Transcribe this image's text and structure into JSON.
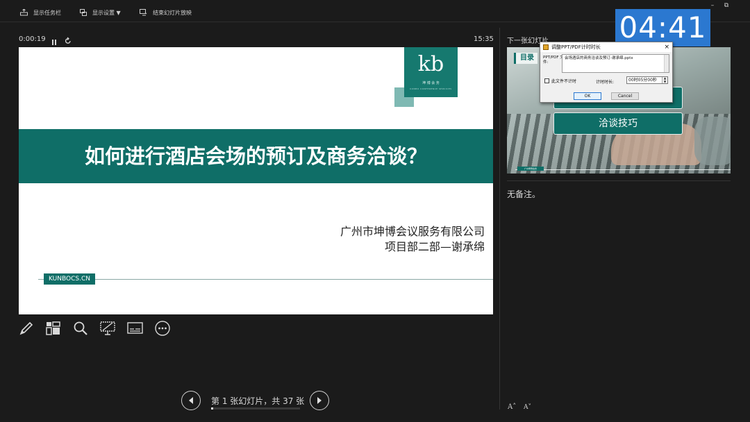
{
  "toolbar": {
    "show_taskbar": "显示任务栏",
    "display_settings": "显示设置 ▼",
    "end_show": "结束幻灯片放映"
  },
  "window": {
    "minimize": "–",
    "restore": "⧉"
  },
  "timer": {
    "countdown": "04:41"
  },
  "presenter": {
    "elapsed": "0:00:19",
    "clock": "15:35"
  },
  "slide": {
    "title": "如何进行酒店会场的预订及商务洽谈？",
    "company": "广州市坤博会议服务有限公司",
    "dept": "项目部二部—谢承绵",
    "url": "KUNBOCS.CN",
    "logo_glyph": "kb",
    "logo_sub": "坤 博 会 务",
    "logo_sub2": "KUNBO CONFERENCE SERVICES"
  },
  "nav": {
    "counter": "第 1 张幻灯片，共 37 张",
    "current": 1,
    "total": 37
  },
  "next_slide": {
    "label": "下一张幻灯片",
    "mulu": "目录",
    "item2": "洽谈技巧",
    "badge": "广州坤博会务"
  },
  "notes": {
    "text": "无备注。"
  },
  "font_controls": {
    "larger": "A˄",
    "smaller": "A˅"
  },
  "dialog": {
    "title": "调整PPT/PDF计时时长",
    "close": "×",
    "file_label": "PPT/PDF 文件:",
    "file_value": "会场酒店的商务洽谈及预订-谢承绵.pptx",
    "no_timer_label": "此文件不计时",
    "duration_label": "计时时长:",
    "duration_value": "00时05分00秒",
    "ok": "OK",
    "cancel": "Cancel"
  },
  "colors": {
    "teal": "#0f6e67",
    "timer_blue": "#2b78d0",
    "background": "#1b1b1b"
  }
}
